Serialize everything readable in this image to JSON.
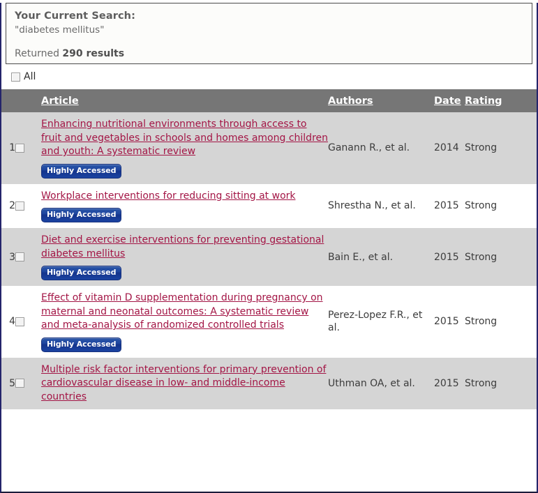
{
  "search_panel": {
    "title": "Your Current Search:",
    "query": "\"diabetes mellitus\"",
    "returned_prefix": "Returned ",
    "returned_count": "290 results"
  },
  "select_all": {
    "label": "All",
    "checked": false
  },
  "table": {
    "headers": {
      "number": "",
      "checkbox": "",
      "article": "Article",
      "authors": "Authors",
      "date": "Date",
      "rating": "Rating"
    },
    "badge_label": "Highly Accessed",
    "rows": [
      {
        "number": "1",
        "title": "Enhancing nutritional environments through access to fruit and vegetables in schools and homes among children and youth: A systematic review",
        "highly_accessed": true,
        "authors": "Ganann R., et al.",
        "date": "2014",
        "rating": "Strong"
      },
      {
        "number": "2",
        "title": "Workplace interventions for reducing sitting at work",
        "highly_accessed": true,
        "authors": "Shrestha N., et al.",
        "date": "2015",
        "rating": "Strong"
      },
      {
        "number": "3",
        "title": "Diet and exercise interventions for preventing gestational diabetes mellitus",
        "highly_accessed": true,
        "authors": "Bain E., et al.",
        "date": "2015",
        "rating": "Strong"
      },
      {
        "number": "4",
        "title": "Effect of vitamin D supplementation during pregnancy on maternal and neonatal outcomes: A systematic review and meta-analysis of randomized controlled trials",
        "highly_accessed": true,
        "authors": "Perez-Lopez F.R., et al.",
        "date": "2015",
        "rating": "Strong"
      },
      {
        "number": "5",
        "title": "Multiple risk factor interventions for primary prevention of cardiovascular disease in low- and middle-income countries",
        "highly_accessed": false,
        "authors": "Uthman OA, et al.",
        "date": "2015",
        "rating": "Strong"
      }
    ]
  },
  "colors": {
    "header_row_bg": "#767676",
    "link": "#a31545",
    "badge_blue": "#1f47a0",
    "stripe_gray": "#d5d5d5",
    "frame_border": "#24246b"
  }
}
